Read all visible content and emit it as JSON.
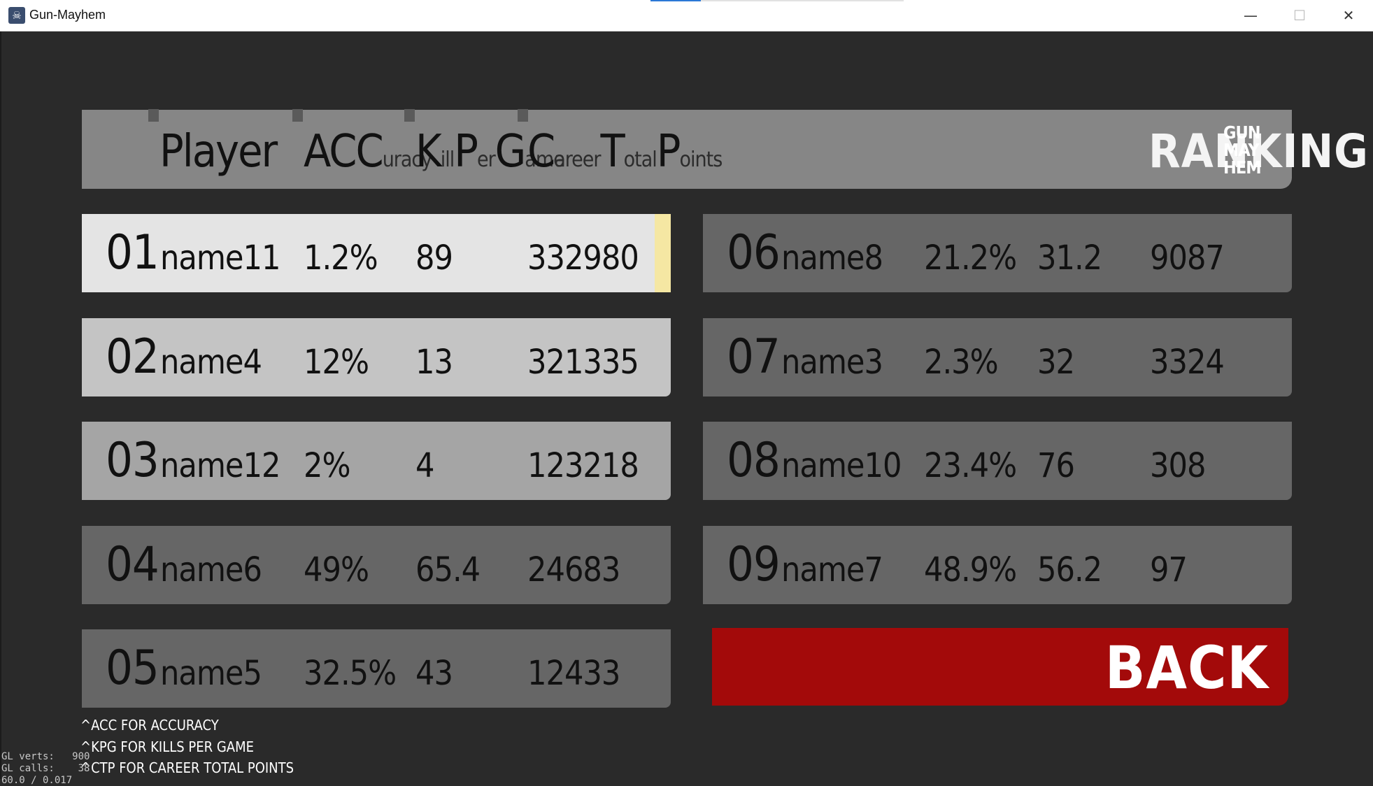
{
  "window": {
    "title": "Gun-Mayhem",
    "icon": "app-icon"
  },
  "header": {
    "cols": {
      "player": "Player",
      "acc_big": "ACC",
      "acc_small": "uracy",
      "kpg_k": "K",
      "kpg_ill": "ill",
      "kpg_p": "P",
      "kpg_er": "er",
      "kpg_g": "G",
      "kpg_ame": "ame",
      "ctp_c": "C",
      "ctp_areer": "areer",
      "ctp_t": "T",
      "ctp_otal": "otal",
      "ctp_p": "P",
      "ctp_oints": "oints"
    },
    "ranking_label": "RANKING",
    "logo_lines": [
      "GUN",
      "MAY",
      "HEM"
    ]
  },
  "rows": [
    {
      "rank": "01",
      "name": "name11",
      "acc": "1.2%",
      "kpg": "89",
      "ctp": "332980",
      "color": "#e4e4e4"
    },
    {
      "rank": "02",
      "name": "name4",
      "acc": "12%",
      "kpg": "13",
      "ctp": "321335",
      "color": "#c4c4c4"
    },
    {
      "rank": "03",
      "name": "name12",
      "acc": "2%",
      "kpg": "4",
      "ctp": "123218",
      "color": "#a5a5a5"
    },
    {
      "rank": "04",
      "name": "name6",
      "acc": "49%",
      "kpg": "65.4",
      "ctp": "24683",
      "color": "#666666"
    },
    {
      "rank": "05",
      "name": "name5",
      "acc": "32.5%",
      "kpg": "43",
      "ctp": "12433",
      "color": "#666666"
    },
    {
      "rank": "06",
      "name": "name8",
      "acc": "21.2%",
      "kpg": "31.2",
      "ctp": "9087",
      "color": "#666666"
    },
    {
      "rank": "07",
      "name": "name3",
      "acc": "2.3%",
      "kpg": "32",
      "ctp": "3324",
      "color": "#666666"
    },
    {
      "rank": "08",
      "name": "name10",
      "acc": "23.4%",
      "kpg": "76",
      "ctp": "308",
      "color": "#666666"
    },
    {
      "rank": "09",
      "name": "name7",
      "acc": "48.9%",
      "kpg": "56.2",
      "ctp": "97",
      "color": "#666666"
    }
  ],
  "back_label": "BACK",
  "footnotes": [
    "^ACC FOR ACCURACY",
    "^KPG FOR KILLS PER GAME",
    "^CTP FOR CAREER TOTAL POINTS"
  ],
  "gl_debug": [
    "GL verts:   900",
    "GL calls:    38",
    "60.0 / 0.017"
  ],
  "colors": {
    "background": "#2a2a2a",
    "header": "#868686",
    "back": "#a30a0a",
    "first_place_marker": "#f5e7a3"
  }
}
